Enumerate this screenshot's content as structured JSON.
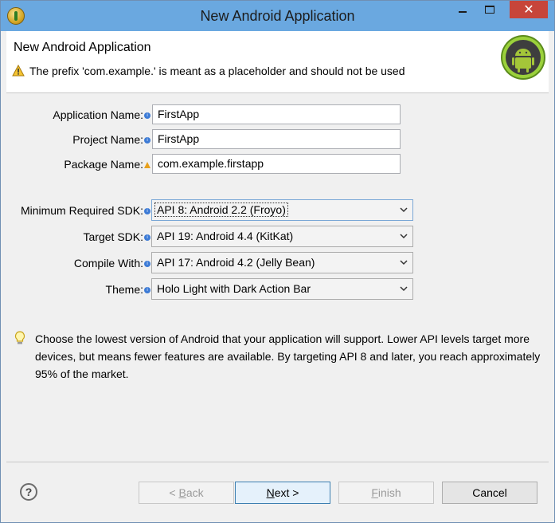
{
  "window": {
    "title": "New Android Application"
  },
  "header": {
    "title": "New Android Application",
    "message": "The prefix 'com.example.' is meant as a placeholder and should not be used"
  },
  "form": {
    "app_name_label": "Application Name:",
    "app_name_value": "FirstApp",
    "project_name_label": "Project Name:",
    "project_name_value": "FirstApp",
    "package_name_label": "Package Name:",
    "package_name_value": "com.example.firstapp",
    "min_sdk_label": "Minimum Required SDK:",
    "min_sdk_value": "API 8: Android 2.2 (Froyo)",
    "target_sdk_label": "Target SDK:",
    "target_sdk_value": "API 19: Android 4.4 (KitKat)",
    "compile_with_label": "Compile With:",
    "compile_with_value": "API 17: Android 4.2 (Jelly Bean)",
    "theme_label": "Theme:",
    "theme_value": "Holo Light with Dark Action Bar"
  },
  "hint": "Choose the lowest version of Android that your application will support. Lower API levels target more devices, but means fewer features are available. By targeting API 8 and later, you reach approximately 95% of the market.",
  "buttons": {
    "back_prefix": "< ",
    "back_mnemonic": "B",
    "back_rest": "ack",
    "next_mnemonic": "N",
    "next_rest": "ext >",
    "finish_mnemonic": "F",
    "finish_rest": "inish",
    "cancel": "Cancel"
  }
}
